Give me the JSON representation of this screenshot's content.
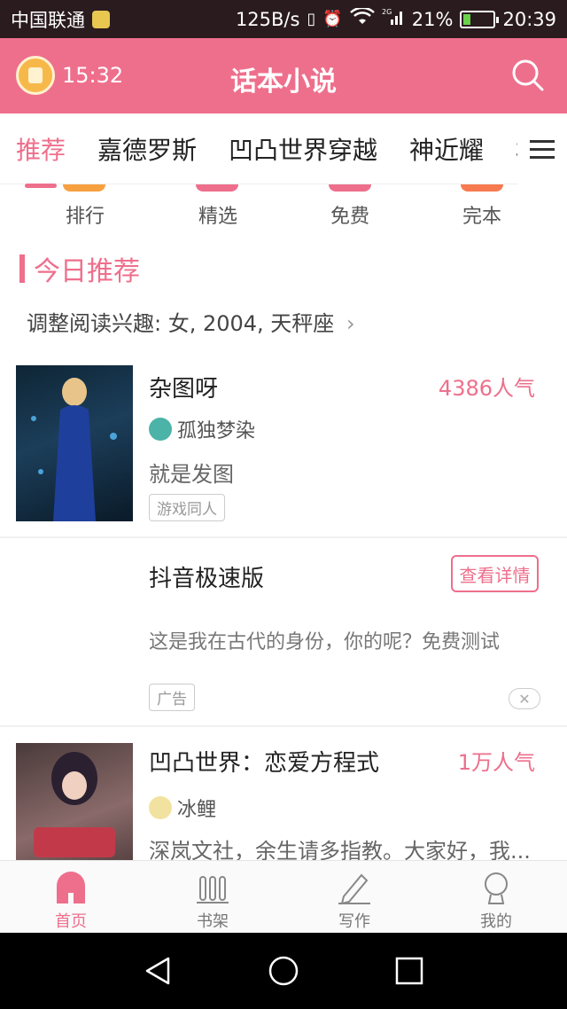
{
  "status_bar": {
    "carrier": "中国联通",
    "speed": "125B/s",
    "network": "2G",
    "battery": "21%",
    "time": "20:39"
  },
  "header": {
    "timer": "15:32",
    "title": "话本小说"
  },
  "tabs": [
    "推荐",
    "嘉德罗斯",
    "凹凸世界穿越",
    "神近耀",
    "格"
  ],
  "quick_entries": [
    "排行",
    "精选",
    "免费",
    "完本"
  ],
  "section": {
    "title": "今日推荐",
    "adjust_text": "调整阅读兴趣: 女, 2004, 天秤座"
  },
  "books": [
    {
      "name": "杂图呀",
      "popularity": "4386人气",
      "author": "孤独梦染",
      "desc": "就是发图",
      "tag": "游戏同人"
    },
    {
      "name": "凹凸世界：恋爱方程式",
      "popularity": "1万人气",
      "author": "冰鲤",
      "desc": "深岚文社，余生请多指教。大家好，我..."
    }
  ],
  "ad": {
    "title": "抖音极速版",
    "button": "查看详情",
    "desc": "这是我在古代的身份，你的呢？免费测试",
    "tag": "广告",
    "close": "✕"
  },
  "bottom_nav": [
    "首页",
    "书架",
    "写作",
    "我的"
  ],
  "colors": {
    "accent": "#ee6f8c",
    "header": "#ee6f8c",
    "statusbar": "#2a1b1f"
  }
}
